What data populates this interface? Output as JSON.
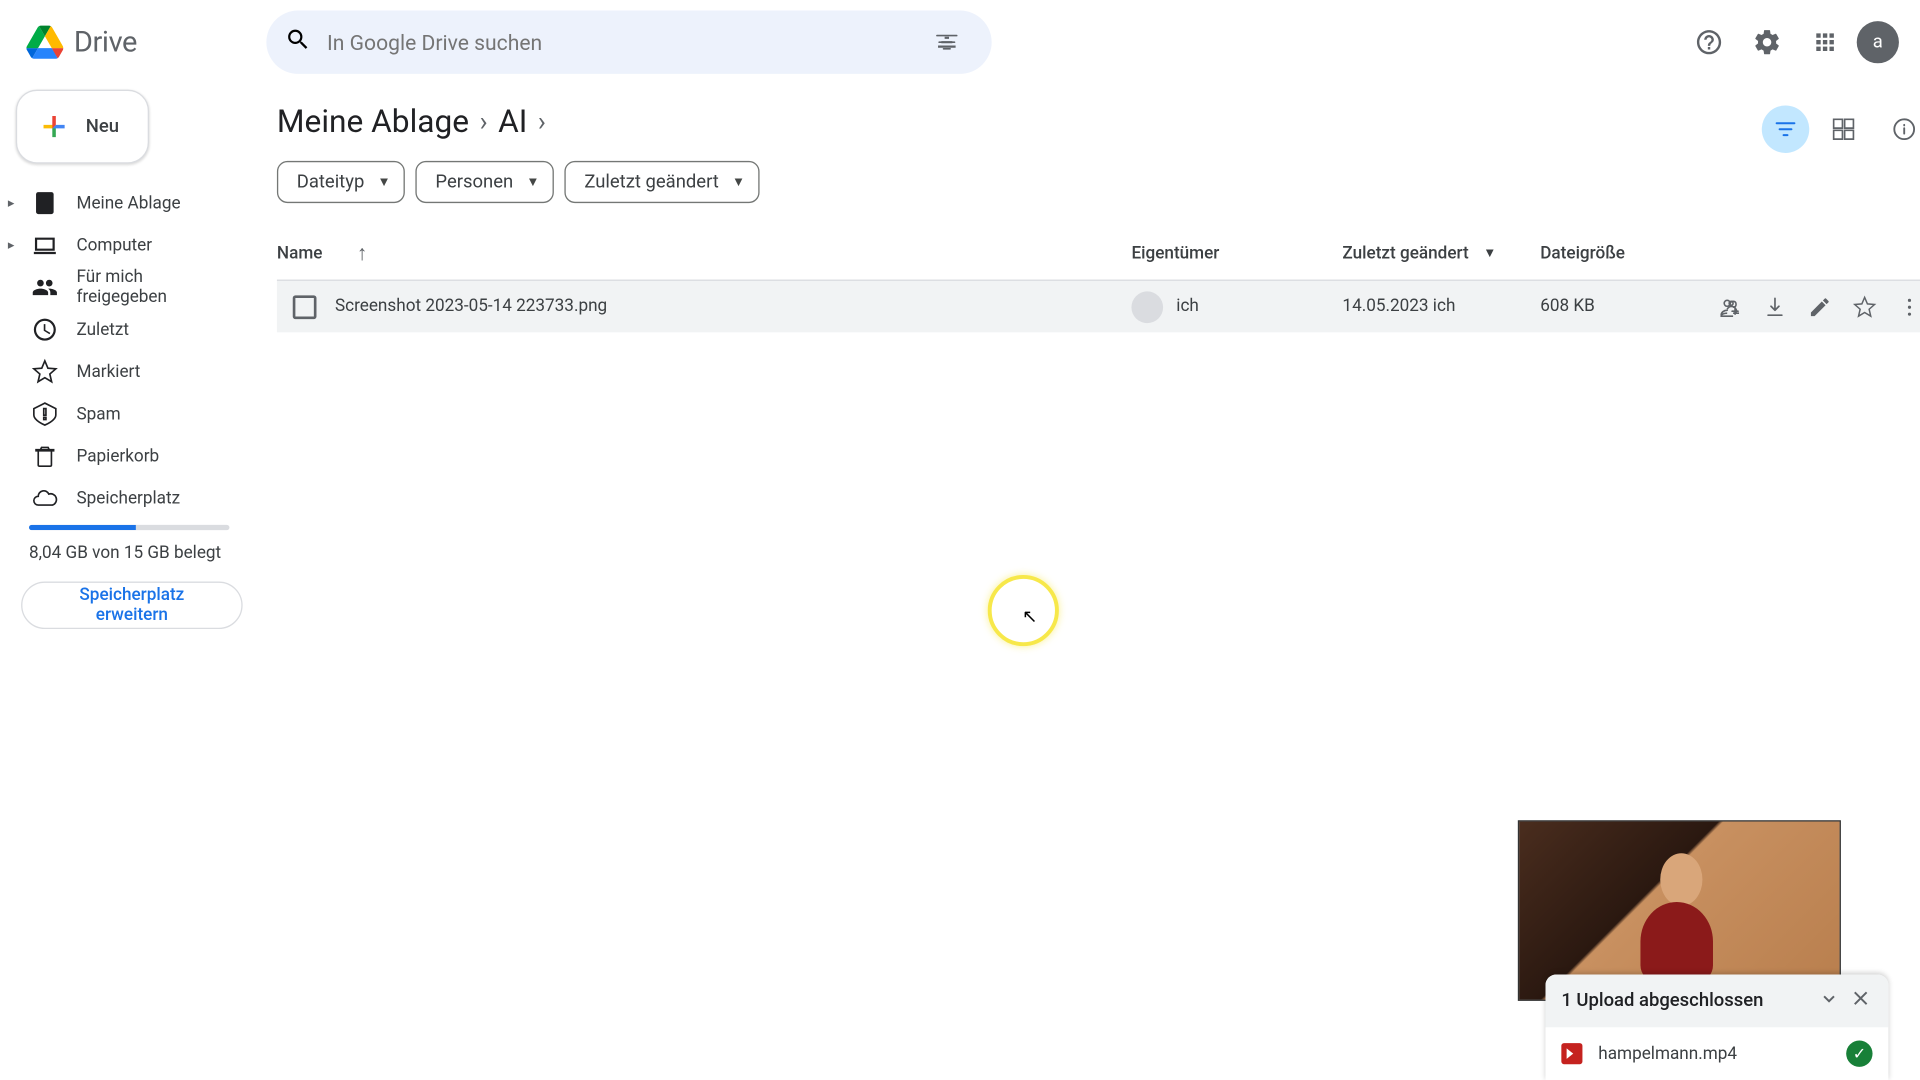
{
  "app": {
    "name": "Drive"
  },
  "search": {
    "placeholder": "In Google Drive suchen"
  },
  "newButton": "Neu",
  "sidebar": {
    "items": [
      {
        "label": "Meine Ablage"
      },
      {
        "label": "Computer"
      },
      {
        "label": "Für mich freigegeben"
      },
      {
        "label": "Zuletzt"
      },
      {
        "label": "Markiert"
      },
      {
        "label": "Spam"
      },
      {
        "label": "Papierkorb"
      },
      {
        "label": "Speicherplatz"
      }
    ],
    "storageText": "8,04 GB von 15 GB belegt",
    "upgrade": "Speicherplatz erweitern"
  },
  "breadcrumb": {
    "root": "Meine Ablage",
    "current": "AI"
  },
  "filters": {
    "type": "Dateityp",
    "people": "Personen",
    "modified": "Zuletzt geändert"
  },
  "columns": {
    "name": "Name",
    "owner": "Eigentümer",
    "modified": "Zuletzt geändert",
    "size": "Dateigröße"
  },
  "rows": [
    {
      "name": "Screenshot 2023-05-14 223733.png",
      "owner": "ich",
      "modified": "14.05.2023 ich",
      "size": "608 KB"
    }
  ],
  "avatar": "a",
  "upload": {
    "title": "1 Upload abgeschlossen",
    "file": "hampelmann.mp4"
  }
}
